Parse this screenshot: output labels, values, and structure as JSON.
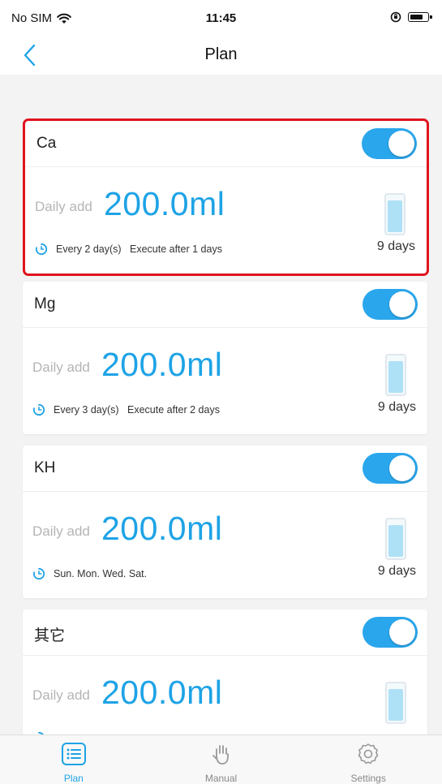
{
  "status_bar": {
    "carrier": "No SIM",
    "time": "11:45"
  },
  "nav": {
    "title": "Plan"
  },
  "colors": {
    "accent": "#1ea3e6",
    "toggle_on": "#2aa6ec",
    "highlight": "#e0141e"
  },
  "plans": [
    {
      "name": "Ca",
      "enabled": true,
      "daily_label": "Daily add",
      "daily_value": "200.0ml",
      "schedule": "Every 2 day(s)   Execute after 1 days",
      "remaining": "9 days",
      "tank_level": 0.82
    },
    {
      "name": "Mg",
      "enabled": true,
      "daily_label": "Daily add",
      "daily_value": "200.0ml",
      "schedule": "Every 3 day(s)   Execute after 2 days",
      "remaining": "9 days",
      "tank_level": 0.82
    },
    {
      "name": "KH",
      "enabled": true,
      "daily_label": "Daily add",
      "daily_value": "200.0ml",
      "schedule": "Sun. Mon. Wed. Sat.",
      "remaining": "9 days",
      "tank_level": 0.82
    },
    {
      "name": "其它",
      "enabled": true,
      "daily_label": "Daily add",
      "daily_value": "200.0ml",
      "schedule": "",
      "remaining": "",
      "tank_level": 0.82
    }
  ],
  "tabs": [
    {
      "label": "Plan",
      "icon": "list-icon",
      "active": true
    },
    {
      "label": "Manual",
      "icon": "hand-icon",
      "active": false
    },
    {
      "label": "Settings",
      "icon": "gear-icon",
      "active": false
    }
  ]
}
